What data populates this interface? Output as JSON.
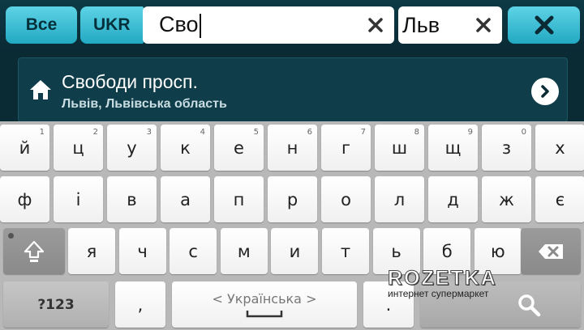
{
  "search": {
    "filter_all": "Все",
    "country": "UKR",
    "street_query": "Сво",
    "city_query": "Льв"
  },
  "result": {
    "title": "Свободи просп.",
    "subtitle": "Львів, Львівська область"
  },
  "keyboard": {
    "row1": [
      {
        "label": "й",
        "hint": "1"
      },
      {
        "label": "ц",
        "hint": "2"
      },
      {
        "label": "у",
        "hint": "3"
      },
      {
        "label": "к",
        "hint": "4"
      },
      {
        "label": "е",
        "hint": "5"
      },
      {
        "label": "н",
        "hint": "6"
      },
      {
        "label": "г",
        "hint": "7"
      },
      {
        "label": "ш",
        "hint": "8"
      },
      {
        "label": "щ",
        "hint": "9"
      },
      {
        "label": "з",
        "hint": "0"
      },
      {
        "label": "х",
        "hint": ""
      }
    ],
    "row2": [
      "ф",
      "і",
      "в",
      "а",
      "п",
      "р",
      "о",
      "л",
      "д",
      "ж",
      "є"
    ],
    "row3": [
      "я",
      "ч",
      "с",
      "м",
      "и",
      "т",
      "ь",
      "б",
      "ю"
    ],
    "symbols_label": "?123",
    "comma_label": ",",
    "period_label": ".",
    "language_label": "< Українська >"
  },
  "watermark": {
    "title": "ROZETKA",
    "subtitle": "интернет супермаркет"
  },
  "colors": {
    "accent": "#22a9c2",
    "background": "#0a2a34",
    "keyboard": "#b8b8b8"
  }
}
